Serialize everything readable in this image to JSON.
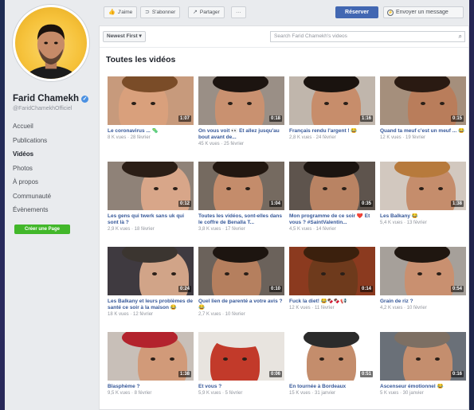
{
  "page": {
    "name": "Farid Chamekh",
    "handle": "@FaridChamekhOfficiel",
    "nav": [
      "Accueil",
      "Publications",
      "Vidéos",
      "Photos",
      "À propos",
      "Communauté",
      "Évènements"
    ],
    "active_nav": "Vidéos",
    "create_page": "Créer une Page"
  },
  "actions": {
    "like": "J'aime",
    "subscribe": "S'abonner",
    "share": "Partager",
    "more": "···",
    "book": "Réserver",
    "message": "Envoyer un message"
  },
  "toolbar": {
    "sort_label": "Newest First ▾",
    "search_placeholder": "Search Farid Chamekh's videos"
  },
  "section_title": "Toutes les vidéos",
  "colors": {
    "accent": "#4267b2",
    "link": "#365899",
    "green": "#42b72a"
  },
  "videos": [
    {
      "title": "Le coronavirus ... 🦠",
      "meta": "8 K vues · 28 février",
      "duration": "1:07",
      "bg": "#c79a7c",
      "skin": "#d9a07c",
      "hair": "#7a4c28"
    },
    {
      "title": "On vous voit 👀 Et allez jusqu'au bout avant de...",
      "meta": "45 K vues · 25 février",
      "duration": "0:18",
      "bg": "#9a8f86",
      "skin": "#c99170",
      "hair": "#1c1410"
    },
    {
      "title": "Français rendu l'argent ! 😂",
      "meta": "2,8 K vues · 24 février",
      "duration": "1:16",
      "bg": "#c0b6ac",
      "skin": "#c78d6b",
      "hair": "#1a130f"
    },
    {
      "title": "Quand ta meuf c'est un meuf ... 😂",
      "meta": "12 K vues · 19 février",
      "duration": "0:15",
      "bg": "#a58f7c",
      "skin": "#b97d5b",
      "hair": "#2a1a12"
    },
    {
      "title": "Les gens qui twerk sans uk qui sont là ?",
      "meta": "2,9 K vues · 18 février",
      "duration": "0:12",
      "bg": "#8f8278",
      "skin": "#d8a689",
      "hair": "#2b1e16"
    },
    {
      "title": "Toutes les vidéos, sont-elles dans le coffre de Benalla T...",
      "meta": "3,8 K vues · 17 février",
      "duration": "1:04",
      "bg": "#756a60",
      "skin": "#c48c6b",
      "hair": "#221710"
    },
    {
      "title": "Mon programme de ce soir ❤️ Et vous ? #SaintValentin...",
      "meta": "4,5 K vues · 14 février",
      "duration": "0:35",
      "bg": "#5e544d",
      "skin": "#b98363",
      "hair": "#1b1410"
    },
    {
      "title": "Les Balkany 😂",
      "meta": "5,4 K vues · 13 février",
      "duration": "1:38",
      "bg": "#d2c8bf",
      "skin": "#c58d6c",
      "hair": "#b77a3c"
    },
    {
      "title": "Les Balkany et leurs problèmes de santé ce soir à la maison 😂",
      "meta": "18 K vues · 12 février",
      "duration": "0:24",
      "bg": "#3f3a40",
      "skin": "#d1a488",
      "hair": "#3b3530"
    },
    {
      "title": "Quel lien de parenté a votre avis ? 😂",
      "meta": "2,7 K vues · 10 février",
      "duration": "0:10",
      "bg": "#6b625b",
      "skin": "#b57f5e",
      "hair": "#1d1510"
    },
    {
      "title": "Fuck la diet! 😂🍫🍫📢",
      "meta": "12 K vues · 11 février",
      "duration": "0:14",
      "bg": "#8b3a1f",
      "skin": "#6e3a1c",
      "hair": "#3b200d"
    },
    {
      "title": "Grain de riz ?",
      "meta": "4,2 K vues · 10 février",
      "duration": "0:54",
      "bg": "#a6a09a",
      "skin": "#c99070",
      "hair": "#1f1610"
    },
    {
      "title": "Blasphème ?",
      "meta": "9,5 K vues · 8 février",
      "duration": "1:38",
      "bg": "#c8bfb8",
      "skin": "#d19a79",
      "hair": "#b3232d"
    },
    {
      "title": "Et vous ?",
      "meta": "5,9 K vues · 5 février",
      "duration": "0:06",
      "bg": "#e8e4df",
      "skin": "#c23a2a",
      "hair": "#e8e4df"
    },
    {
      "title": "En tournée à Bordeaux",
      "meta": "15 K vues · 31 janvier",
      "duration": "0:51",
      "bg": "#ffffff",
      "skin": "#c48d6c",
      "hair": "#2b2b2b"
    },
    {
      "title": "Ascenseur émotionnel 😂",
      "meta": "5 K vues · 30 janvier",
      "duration": "0:16",
      "bg": "#6a7078",
      "skin": "#c48e6e",
      "hair": "#7d6f63"
    }
  ]
}
